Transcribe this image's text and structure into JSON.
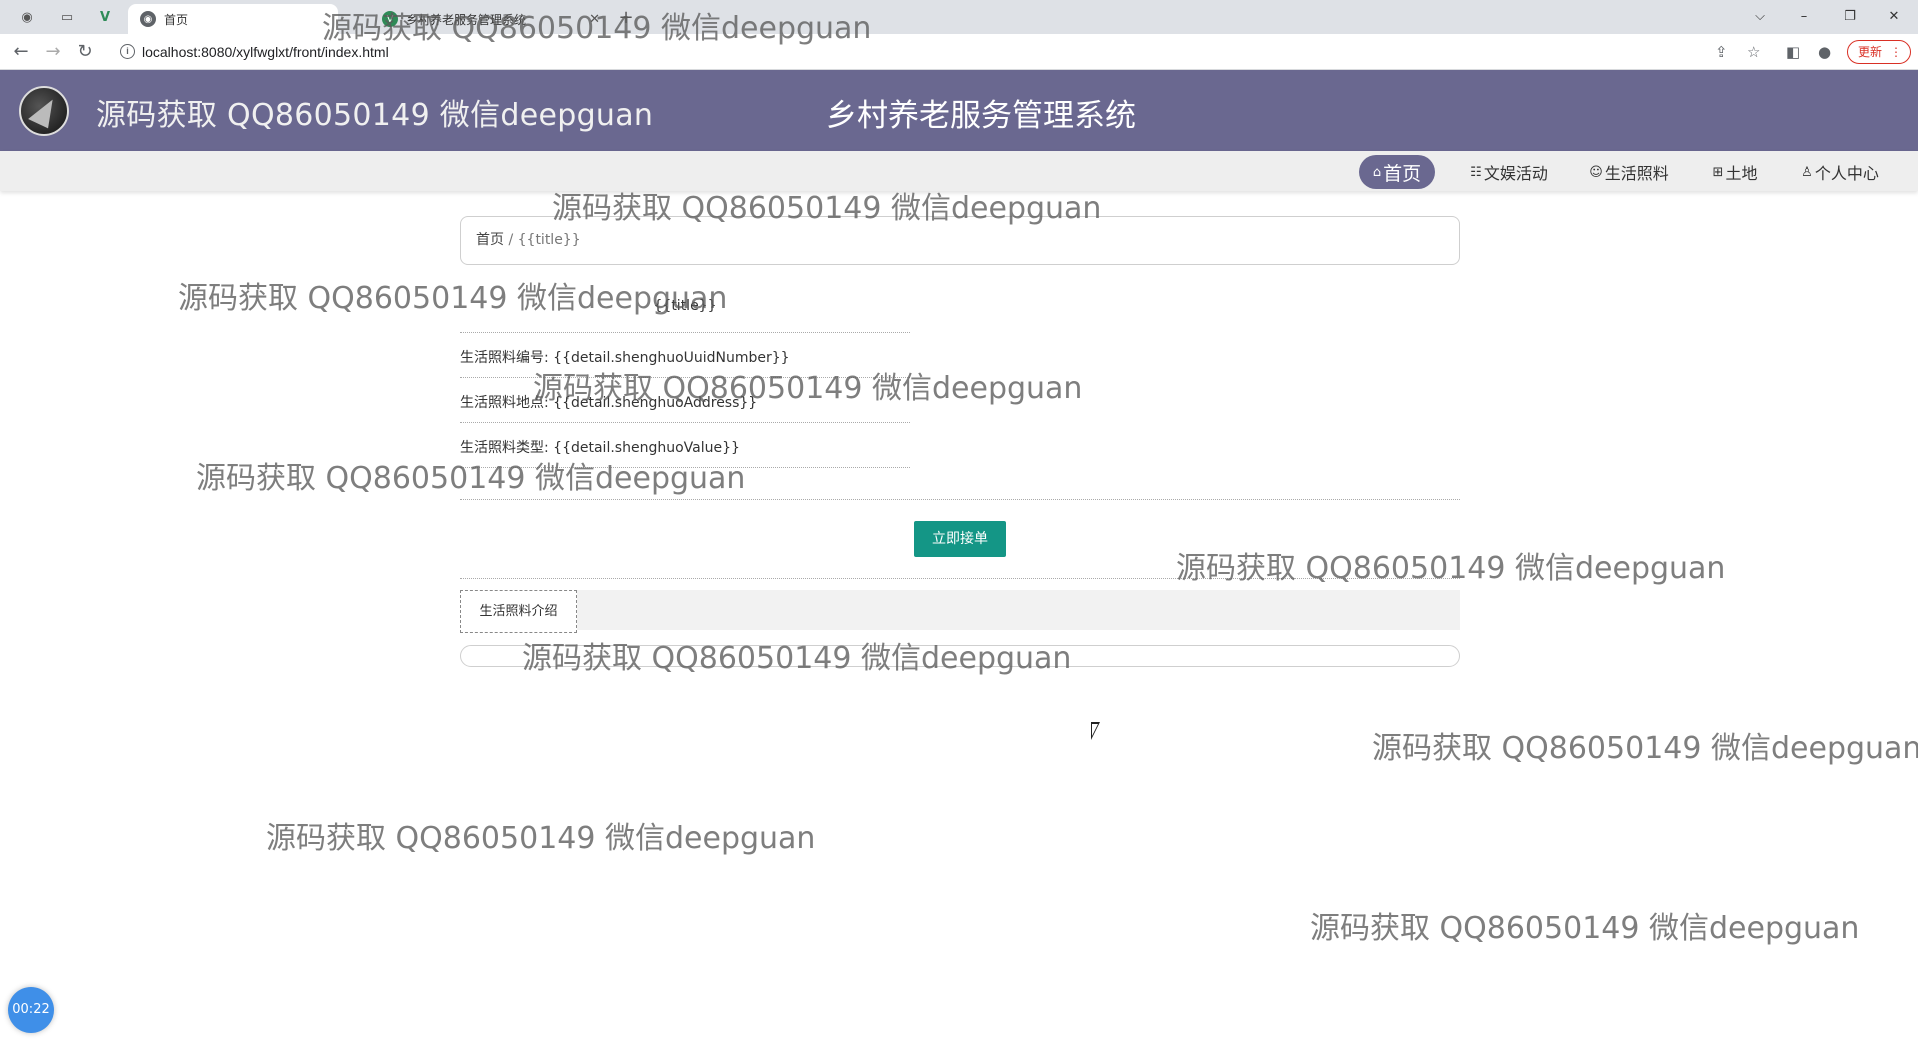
{
  "browser": {
    "tabs": [
      {
        "label": "首页",
        "active": true
      },
      {
        "label": "乡村养老服务管理系统",
        "active": false
      }
    ],
    "url": "localhost:8080/xylfwglxt/front/index.html",
    "update_label": "更新",
    "window_controls": {
      "minimize": "–",
      "restore": "❐",
      "close": "✕",
      "dropdown": "⌵"
    },
    "icons": {
      "back": "arrow-left-icon",
      "forward": "arrow-right-icon",
      "reload": "reload-icon",
      "info": "info-icon",
      "share": "share-icon",
      "star": "star-icon",
      "sidepanel": "sidepanel-icon",
      "profile": "profile-icon",
      "more": "more-icon"
    }
  },
  "header": {
    "left_text": "源码获取 QQ86050149 微信deepguan",
    "title": "乡村养老服务管理系统"
  },
  "nav": {
    "items": [
      {
        "label": "首页",
        "icon": "⌂",
        "active": true
      },
      {
        "label": "文娱活动",
        "icon": "☷",
        "active": false
      },
      {
        "label": "生活照料",
        "icon": "☺",
        "active": false
      },
      {
        "label": "土地",
        "icon": "⊞",
        "active": false
      },
      {
        "label": "个人中心",
        "icon": "♙",
        "active": false
      }
    ]
  },
  "breadcrumb": {
    "home": "首页",
    "separator": "/",
    "current": "{{title}}"
  },
  "detail": {
    "title": "{{title}}",
    "fields": [
      {
        "label": "生活照料编号:",
        "value": "{{detail.shenghuoUuidNumber}}"
      },
      {
        "label": "生活照料地点:",
        "value": "{{detail.shenghuoAddress}}"
      },
      {
        "label": "生活照料类型:",
        "value": "{{detail.shenghuoValue}}"
      }
    ],
    "order_button": "立即接单",
    "intro_tab": "生活照料介绍"
  },
  "watermark_text": "源码获取 QQ86050149 微信deepguan",
  "timer": "00:22",
  "colors": {
    "header_bg": "#6a6890",
    "button_bg": "#149686",
    "timer_bg": "#3f8fe8"
  }
}
